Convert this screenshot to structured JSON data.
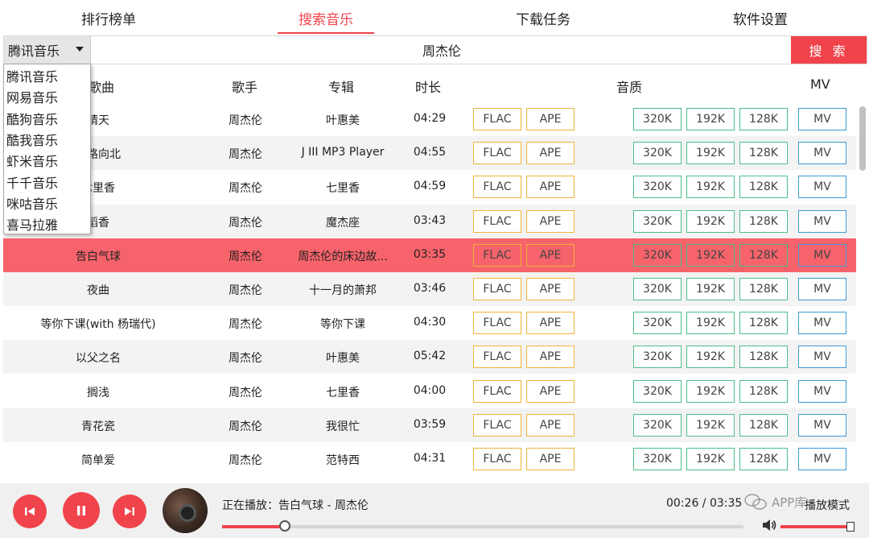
{
  "tabs": [
    {
      "label": "排行榜单",
      "active": false
    },
    {
      "label": "搜索音乐",
      "active": true
    },
    {
      "label": "下载任务",
      "active": false
    },
    {
      "label": "软件设置",
      "active": false
    }
  ],
  "search": {
    "source_selected": "腾讯音乐",
    "query": "周杰伦",
    "button_label": "搜 索"
  },
  "dropdown": {
    "options": [
      "腾讯音乐",
      "网易音乐",
      "酷狗音乐",
      "酷我音乐",
      "虾米音乐",
      "千千音乐",
      "咪咕音乐",
      "喜马拉雅"
    ]
  },
  "columns": {
    "song": "歌曲",
    "singer": "歌手",
    "album": "专辑",
    "duration": "时长",
    "quality": "音质",
    "mv": "MV"
  },
  "quality_labels": {
    "flac": "FLAC",
    "ape": "APE",
    "q320": "320K",
    "q192": "192K",
    "q128": "128K",
    "mv": "MV"
  },
  "rows": [
    {
      "song": "晴天",
      "singer": "周杰伦",
      "album": "叶惠美",
      "duration": "04:29"
    },
    {
      "song": "一路向北",
      "singer": "周杰伦",
      "album": "J III MP3 Player",
      "duration": "04:55"
    },
    {
      "song": "七里香",
      "singer": "周杰伦",
      "album": "七里香",
      "duration": "04:59"
    },
    {
      "song": "稻香",
      "singer": "周杰伦",
      "album": "魔杰座",
      "duration": "03:43"
    },
    {
      "song": "告白气球",
      "singer": "周杰伦",
      "album": "周杰伦的床边故...",
      "duration": "03:35"
    },
    {
      "song": "夜曲",
      "singer": "周杰伦",
      "album": "十一月的萧邦",
      "duration": "03:46"
    },
    {
      "song": "等你下课(with 杨瑞代)",
      "singer": "周杰伦",
      "album": "等你下课",
      "duration": "04:30"
    },
    {
      "song": "以父之名",
      "singer": "周杰伦",
      "album": "叶惠美",
      "duration": "05:42"
    },
    {
      "song": "搁浅",
      "singer": "周杰伦",
      "album": "七里香",
      "duration": "04:00"
    },
    {
      "song": "青花瓷",
      "singer": "周杰伦",
      "album": "我很忙",
      "duration": "03:59"
    },
    {
      "song": "简单爱",
      "singer": "周杰伦",
      "album": "范特西",
      "duration": "04:31"
    }
  ],
  "active_row_index": 4,
  "player": {
    "now_playing": "正在播放：告白气球 - 周杰伦",
    "time": "00:26 / 03:35",
    "progress": 0.12,
    "volume": 0.97,
    "mode_label": "播放模式",
    "watermark": "APP库"
  },
  "colors": {
    "accent": "#f0434b",
    "active_row": "#f7636b",
    "lossless_border": "#f0b43a",
    "quality_border": "#4cbf8a",
    "mv_border": "#3a9ad6"
  }
}
